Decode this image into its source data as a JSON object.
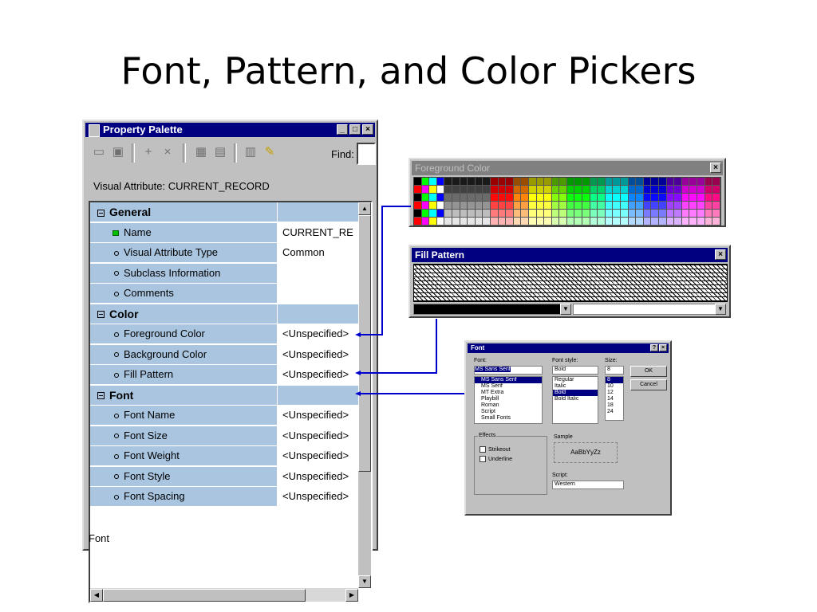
{
  "slide": {
    "title": "Font, Pattern, and Color Pickers"
  },
  "property_palette": {
    "title": "Property Palette",
    "window_buttons": [
      "_",
      "□",
      "×"
    ],
    "toolbar_icons": [
      "copy-properties-icon",
      "paste-properties-icon",
      "add-property-icon",
      "delete-property-icon",
      "union-icon",
      "intersect-icon",
      "inherit-icon",
      "freeze-icon"
    ],
    "find_label": "Find:",
    "visual_attribute_label": "Visual Attribute: CURRENT_RECORD",
    "rows": [
      {
        "kind": "header",
        "label": "General",
        "value": ""
      },
      {
        "kind": "prop",
        "label": "Name",
        "value": "CURRENT_RE"
      },
      {
        "kind": "prop",
        "label": "Visual Attribute Type",
        "value": "Common"
      },
      {
        "kind": "prop",
        "label": "Subclass Information",
        "value": ""
      },
      {
        "kind": "prop",
        "label": "Comments",
        "value": ""
      },
      {
        "kind": "header",
        "label": "Color",
        "value": ""
      },
      {
        "kind": "prop",
        "label": "Foreground Color",
        "value": "<Unspecified>"
      },
      {
        "kind": "prop",
        "label": "Background Color",
        "value": "<Unspecified>"
      },
      {
        "kind": "prop",
        "label": "Fill Pattern",
        "value": "<Unspecified>"
      },
      {
        "kind": "header",
        "label": "Font",
        "value": ""
      },
      {
        "kind": "prop",
        "label": "Font Name",
        "value": "<Unspecified>"
      },
      {
        "kind": "prop",
        "label": "Font Size",
        "value": "<Unspecified>"
      },
      {
        "kind": "prop",
        "label": "Font Weight",
        "value": "<Unspecified>"
      },
      {
        "kind": "prop",
        "label": "Font Style",
        "value": "<Unspecified>"
      },
      {
        "kind": "prop",
        "label": "Font Spacing",
        "value": "<Unspecified>"
      }
    ],
    "status": "Font"
  },
  "foreground_color": {
    "title": "Foreground Color",
    "close": "×"
  },
  "fill_pattern": {
    "title": "Fill Pattern",
    "close": "×"
  },
  "font_dialog": {
    "title": "Font",
    "title_buttons": [
      "?",
      "×"
    ],
    "font_label": "Font:",
    "font_value": "MS Sans Serif",
    "font_list": [
      "MS Sans Serif",
      "MS Serif",
      "MT Extra",
      "Playbill",
      "Roman",
      "Script",
      "Small Fonts"
    ],
    "style_label": "Font style:",
    "style_value": "Bold",
    "style_list": [
      "Regular",
      "Italic",
      "Bold",
      "Bold Italic"
    ],
    "size_label": "Size:",
    "size_value": "8",
    "size_list": [
      "8",
      "10",
      "12",
      "14",
      "18",
      "24"
    ],
    "ok": "OK",
    "cancel": "Cancel",
    "effects_label": "Effects",
    "strikeout": "Strikeout",
    "underline": "Underline",
    "sample_label": "Sample",
    "sample_text": "AaBbYyZz",
    "script_label": "Script:",
    "script_value": "Western"
  },
  "colors": {
    "title_active": "#000080",
    "grid_cell": "#a9c5e0",
    "connector": "#0000cc"
  }
}
